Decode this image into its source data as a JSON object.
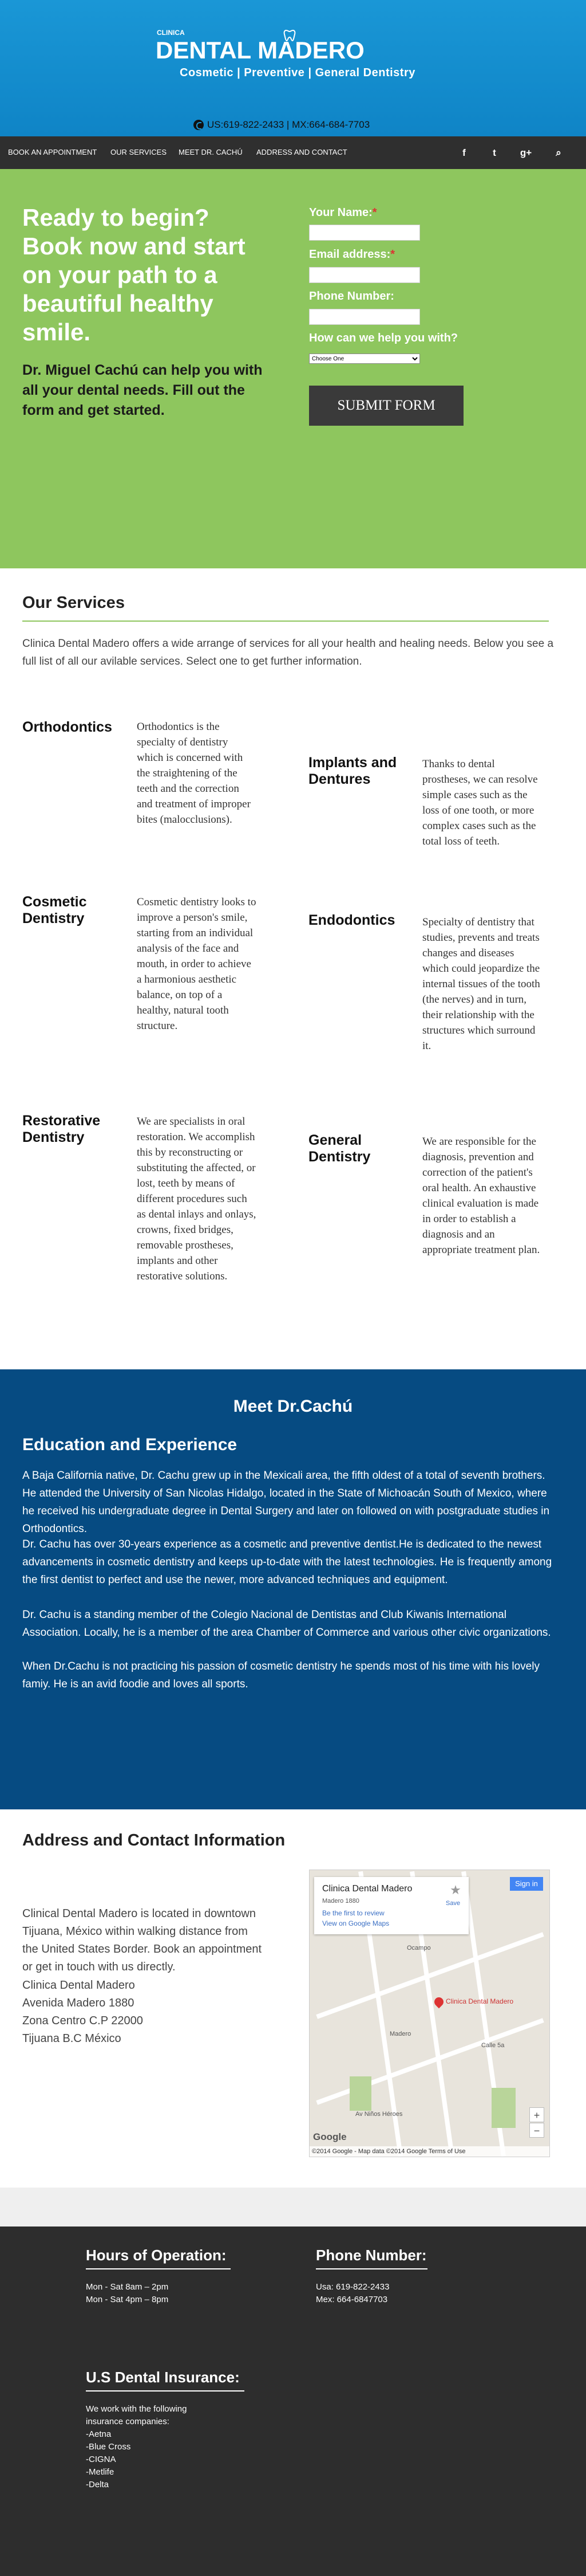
{
  "header": {
    "clinic_label": "CLINICA",
    "brand": "DENTAL MADERO",
    "slogan": "Cosmetic | Preventive | General Dentistry",
    "phone": "US:619-822-2433 | MX:664-684-7703"
  },
  "nav": {
    "items": [
      "BOOK AN APPOINTMENT",
      "OUR SERVICES",
      "MEET DR. CACHÚ",
      "ADDRESS AND CONTACT"
    ],
    "icons": [
      "facebook-icon",
      "twitter-icon",
      "google-plus-icon",
      "search-icon"
    ],
    "icon_glyphs": [
      "f",
      "t",
      "g+",
      "⌕"
    ]
  },
  "hero": {
    "headline": "Ready to begin? Book now and start on your path to a beautiful healthy  smile.",
    "subtext": "Dr. Miguel Cachú can help you with all your dental needs. Fill out the form and get started.",
    "form": {
      "name_label": "Your Name:",
      "email_label": "Email address:",
      "phone_label": "Phone Number:",
      "help_label": "How can we help you with?",
      "required_mark": "*",
      "select_value": "Choose One",
      "submit": "SUBMIT FORM"
    }
  },
  "services": {
    "title": "Our Services",
    "intro": "Clinica Dental Madero offers a wide arrange of services for all your health and healing needs. Below you see a full list of all our avilable services. Select one to get further information.",
    "items": [
      {
        "name": "Orthodontics",
        "desc": "Orthodontics is the specialty of dentistry which is concerned with the straightening of the teeth and the correction and treatment of improper bites (malocclusions)."
      },
      {
        "name": "Implants and Dentures",
        "desc": "Thanks to dental prostheses, we can resolve simple cases such as the loss of one tooth, or more complex cases such as the total loss of teeth."
      },
      {
        "name": "Cosmetic Dentistry",
        "desc": "Cosmetic dentistry looks to improve a person's smile, starting from an individual analysis of the face and mouth, in order to achieve a harmonious aesthetic balance, on top of a healthy, natural tooth structure."
      },
      {
        "name": "Endodontics",
        "desc": "Specialty of dentistry that studies, prevents and treats changes and diseases which could jeopardize the internal tissues of the tooth (the nerves) and in turn, their relationship with the structures which surround it."
      },
      {
        "name": "Restorative Dentistry",
        "desc": "We are specialists in oral restoration. We accomplish this by reconstructing or substituting the affected, or lost, teeth by means of different procedures such as dental inlays and onlays, crowns, fixed bridges, removable prostheses, implants and other restorative solutions."
      },
      {
        "name": "General Dentistry",
        "desc": "We are responsible for the diagnosis, prevention and correction of the patient's oral health. An exhaustive clinical evaluation is made in order to establish a diagnosis and an appropriate treatment plan."
      }
    ]
  },
  "doctor": {
    "title": "Meet Dr.Cachú",
    "subtitle": "Education and Experience",
    "paragraphs": [
      "A Baja California native, Dr. Cachu grew up in the Mexicali area, the fifth oldest of a total of seventh brothers. He attended the University of San Nicolas Hidalgo, located in the State of Michoacán South of Mexico, where he received his undergraduate degree in Dental Surgery and later on followed on with postgraduate studies in Orthodontics.",
      "Dr. Cachu has over 30-years experience as a cosmetic and preventive dentist.He is dedicated to the newest advancements in cosmetic dentistry and keeps up-to-date with the latest technologies. He is frequently among the first dentist to perfect and use the newer, more advanced techniques and equipment.",
      "Dr. Cachu is a standing member of the Colegio Nacional de Dentistas and Club Kiwanis International Association. Locally, he is a member of the area Chamber of Commerce and various other civic organizations.",
      "When Dr.Cachu is not practicing his passion of cosmetic dentistry he spends most of his time with his lovely famiy. He is an avid foodie and loves all sports."
    ]
  },
  "address": {
    "title": "Address and Contact Information",
    "intro": "Clinical Dental Madero is located in downtown Tijuana, México within walking distance from the United States Border. Book an  appointment or get in touch with us directly.",
    "lines": [
      "Clinica Dental Madero",
      "Avenida Madero 1880",
      "Zona Centro C.P 22000",
      "Tijuana B.C México"
    ],
    "map": {
      "place": "Clinica Dental Madero",
      "street": "Madero 1880",
      "link1": "Be the first to review",
      "link2": "View on Google Maps",
      "save": "Save",
      "sign_in": "Sign in",
      "pin_label": "Clinica Dental Madero",
      "google": "Google",
      "footer": "©2014 Google - Map data ©2014 Google  Terms of Use",
      "zoom_in": "+",
      "zoom_out": "−",
      "streets": [
        "Ocampo",
        "Madero",
        "Av Niños Héroes",
        "Calle 5a"
      ]
    }
  },
  "footer": {
    "hours_title": "Hours of Operation:",
    "hours": [
      "Mon - Sat 8am – 2pm",
      "Mon - Sat 4pm – 8pm"
    ],
    "phone_title": "Phone Number:",
    "phones": [
      "Usa: 619-822-2433",
      "Mex: 664-6847703"
    ],
    "insurance_title": "U.S Dental Insurance:",
    "insurance_intro": "We work with the following insurance companies:",
    "insurers": [
      "-Aetna",
      "-Blue Cross",
      "-CIGNA",
      "-Metlife",
      "-Delta"
    ]
  },
  "colors": {
    "header_blue": "#1a97d6",
    "nav_dark": "#2f2f2f",
    "hero_green": "#8ec65e",
    "doctor_blue": "#064b82",
    "footer_dark": "#2d2d2d"
  }
}
